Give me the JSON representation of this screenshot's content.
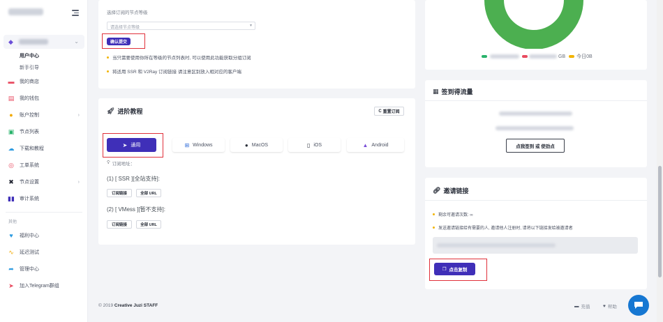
{
  "sidebar": {
    "user_menu": {
      "sub_items": [
        "用户中心",
        "新手引导"
      ]
    },
    "items": [
      {
        "label": "我的商店",
        "icon": "shop-icon",
        "color": "#e84a5f"
      },
      {
        "label": "我的钱包",
        "icon": "wallet-icon",
        "color": "#e84a5f"
      },
      {
        "label": "账户控制",
        "icon": "account-icon",
        "color": "#f2a900",
        "has_children": true
      },
      {
        "label": "节点列表",
        "icon": "node-list-icon",
        "color": "#29b36b"
      },
      {
        "label": "下载和教程",
        "icon": "cloud-icon",
        "color": "#2d9be0"
      },
      {
        "label": "工单系统",
        "icon": "ticket-icon",
        "color": "#e84a5f"
      },
      {
        "label": "节点设置",
        "icon": "tools-icon",
        "color": "#1f2330",
        "has_children": true
      },
      {
        "label": "审计系统",
        "icon": "audit-icon",
        "color": "#3f2fb8"
      }
    ],
    "section_label": "其他",
    "other_items": [
      {
        "label": "福利中心",
        "icon": "heart-icon",
        "color": "#2d9be0"
      },
      {
        "label": "延迟测试",
        "icon": "pulse-icon",
        "color": "#f2a900"
      },
      {
        "label": "管理中心",
        "icon": "share-icon",
        "color": "#2d9be0"
      },
      {
        "label": "加入Telegram群组",
        "icon": "telegram-icon",
        "color": "#e84a5f"
      }
    ]
  },
  "node_level": {
    "label": "选择订阅的节点等级",
    "select_placeholder": "请选择节点等级",
    "confirm_button": "确认提交",
    "notes": [
      "当只需要使用你所在等级的节点列表时, 可以使用此功能获取分组订阅",
      "将适用 SSR 和 V2Ray 订阅链接 请注意区别放入相对应的客户端"
    ]
  },
  "tutorial": {
    "title": "进阶教程",
    "reset_button": "重置订阅",
    "tabs": [
      {
        "label": "通用",
        "icon": "telegram-icon",
        "active": true
      },
      {
        "label": "Windows",
        "icon": "windows-icon",
        "active": false
      },
      {
        "label": "MacOS",
        "icon": "apple-icon",
        "active": false
      },
      {
        "label": "iOS",
        "icon": "mobile-icon",
        "active": false
      },
      {
        "label": "Android",
        "icon": "android-icon",
        "active": false
      }
    ],
    "subscribe_label": "订阅地址：",
    "ssr_line": "(1) [ SSR ][全站支持]:",
    "vmess_line": "(2) [ VMess ][暂不支持]:",
    "copy_link": "订阅链接",
    "copy_all": "全部 URL"
  },
  "traffic": {
    "legend_partial_1": "GB",
    "legend_today": "今日0B",
    "ring_color": "#4caf50"
  },
  "checkin": {
    "title": "签到得流量",
    "button": "点我签到 或 使劲点"
  },
  "invite": {
    "title": "邀请链接",
    "remaining": "剩余可邀请次数: ∞",
    "note": "发送邀请链接给有需要的人, 邀请他人注册时, 请将以下链接发给被邀请者",
    "copy_button": "点击复制"
  },
  "footer": {
    "copyright_prefix": "© 2019",
    "brand": "Creative Juzi",
    "staff": "STAFF",
    "link1": "充值",
    "link2": "帮助"
  }
}
